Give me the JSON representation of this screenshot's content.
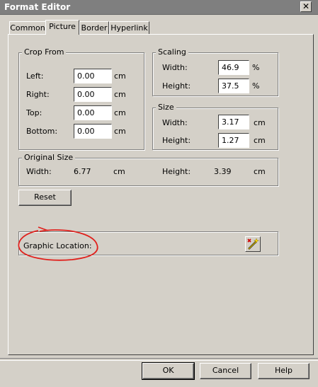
{
  "window": {
    "title": "Format Editor",
    "close_glyph": "✕"
  },
  "tabs": [
    {
      "label": "Common",
      "active": false
    },
    {
      "label": "Picture",
      "active": true
    },
    {
      "label": "Border",
      "active": false
    },
    {
      "label": "Hyperlink",
      "active": false
    }
  ],
  "crop_from": {
    "title": "Crop From",
    "left_label": "Left:",
    "left_value": "0.00",
    "right_label": "Right:",
    "right_value": "0.00",
    "top_label": "Top:",
    "top_value": "0.00",
    "bottom_label": "Bottom:",
    "bottom_value": "0.00",
    "unit": "cm"
  },
  "scaling": {
    "title": "Scaling",
    "width_label": "Width:",
    "width_value": "46.9",
    "height_label": "Height:",
    "height_value": "37.5",
    "unit": "%"
  },
  "size": {
    "title": "Size",
    "width_label": "Width:",
    "width_value": "3.17",
    "height_label": "Height:",
    "height_value": "1.27",
    "unit": "cm"
  },
  "original_size": {
    "title": "Original Size",
    "width_label": "Width:",
    "width_value": "6.77",
    "height_label": "Height:",
    "height_value": "3.39",
    "unit": "cm"
  },
  "reset_label": "Reset",
  "graphic_location": {
    "label": "Graphic Location:",
    "button_icon": "magic-wand-icon"
  },
  "footer": {
    "ok_label": "OK",
    "cancel_label": "Cancel",
    "help_label": "Help"
  },
  "colors": {
    "dialog_bg": "#d4d0c8",
    "titlebar_bg": "#7f7f7f",
    "annotation": "#e0201c"
  }
}
